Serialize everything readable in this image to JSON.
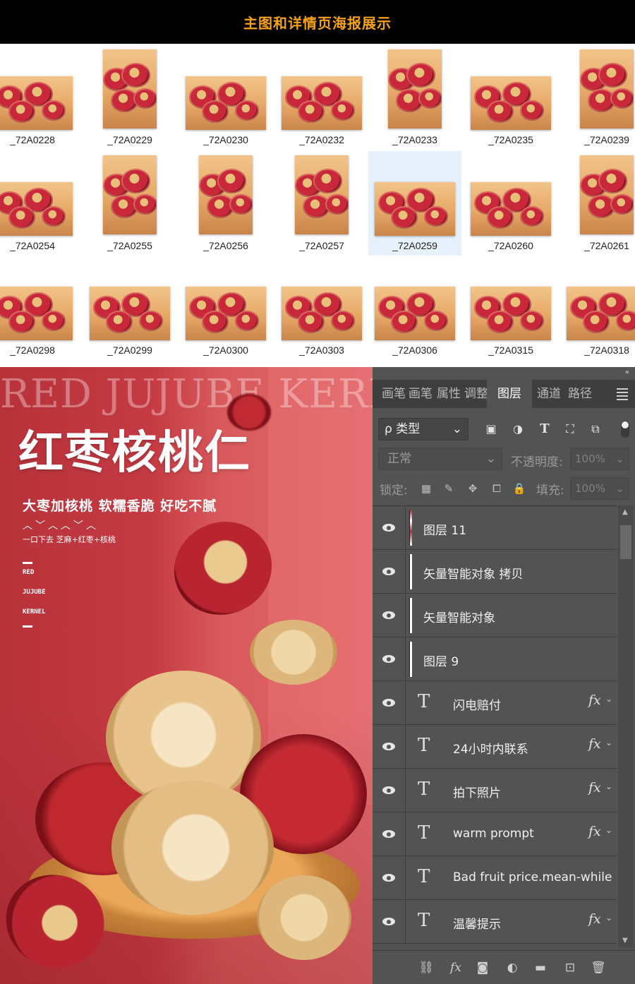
{
  "header": {
    "title": "主图和详情页海报展示"
  },
  "thumbnails": [
    {
      "label": "_72A0228",
      "orientation": "landscape",
      "selected": false
    },
    {
      "label": "_72A0229",
      "orientation": "portrait",
      "selected": false
    },
    {
      "label": "_72A0230",
      "orientation": "landscape",
      "selected": false
    },
    {
      "label": "_72A0232",
      "orientation": "landscape",
      "selected": false
    },
    {
      "label": "_72A0233",
      "orientation": "portrait",
      "selected": false
    },
    {
      "label": "_72A0235",
      "orientation": "landscape",
      "selected": false
    },
    {
      "label": "_72A0239",
      "orientation": "portrait",
      "selected": false
    },
    {
      "label": "_72A0254",
      "orientation": "landscape",
      "selected": false
    },
    {
      "label": "_72A0255",
      "orientation": "portrait",
      "selected": false
    },
    {
      "label": "_72A0256",
      "orientation": "portrait",
      "selected": false
    },
    {
      "label": "_72A0257",
      "orientation": "portrait",
      "selected": false
    },
    {
      "label": "_72A0259",
      "orientation": "landscape",
      "selected": true
    },
    {
      "label": "_72A0260",
      "orientation": "landscape",
      "selected": false
    },
    {
      "label": "_72A0261",
      "orientation": "portrait",
      "selected": false
    },
    {
      "label": "_72A0298",
      "orientation": "landscape",
      "selected": false
    },
    {
      "label": "_72A0299",
      "orientation": "landscape",
      "selected": false
    },
    {
      "label": "_72A0300",
      "orientation": "landscape",
      "selected": false
    },
    {
      "label": "_72A0303",
      "orientation": "landscape",
      "selected": false
    },
    {
      "label": "_72A0306",
      "orientation": "landscape",
      "selected": false
    },
    {
      "label": "_72A0315",
      "orientation": "landscape",
      "selected": false
    },
    {
      "label": "_72A0318",
      "orientation": "landscape",
      "selected": false
    }
  ],
  "poster": {
    "english_title": "RED JUJUBE KERNEL",
    "title": "红枣核桃仁",
    "subtitle": "大枣加核桃 软糯香脆 好吃不腻",
    "wave": "︿﹀︿︿﹀︿",
    "tagline": "一口下去 芝麻+红枣+核桃",
    "small_lines": [
      "RED",
      "JUJUBE",
      "KERNEL"
    ]
  },
  "layers_panel": {
    "collapse_glyph": "«",
    "tabs": [
      {
        "label": "画笔",
        "active": false
      },
      {
        "label": "画笔",
        "active": false
      },
      {
        "label": "属性",
        "active": false
      },
      {
        "label": "调整",
        "active": false
      },
      {
        "label": "图层",
        "active": true
      },
      {
        "label": "通道",
        "active": false
      },
      {
        "label": "路径",
        "active": false
      }
    ],
    "filter": {
      "label": "ρ 类型",
      "chevron": "⌄"
    },
    "filter_icons": [
      "image-filter-icon",
      "adjustment-filter-icon",
      "type-filter-icon",
      "shape-filter-icon",
      "smart-object-filter-icon"
    ],
    "filter_glyphs": [
      "▣",
      "◑",
      "T",
      "⛶",
      "⧉"
    ],
    "blend_mode": "正常",
    "opacity_label": "不透明度:",
    "opacity_value": "100%",
    "lock_label": "锁定:",
    "lock_glyphs": [
      "▦",
      "✎",
      "✥",
      "⧠",
      "🔒"
    ],
    "fill_label": "填充:",
    "fill_value": "100%",
    "layers": [
      {
        "type": "image",
        "name": "图层 11",
        "fx": false,
        "thumb": "colored"
      },
      {
        "type": "image",
        "name": "矢量智能对象 拷贝",
        "fx": false,
        "thumb": "plain"
      },
      {
        "type": "image",
        "name": "矢量智能对象",
        "fx": false,
        "thumb": "plain"
      },
      {
        "type": "image",
        "name": "图层 9",
        "fx": false,
        "thumb": "plain"
      },
      {
        "type": "text",
        "name": "闪电赔付",
        "fx": true
      },
      {
        "type": "text",
        "name": "24小时内联系",
        "fx": true
      },
      {
        "type": "text",
        "name": "拍下照片",
        "fx": true
      },
      {
        "type": "text",
        "name": "warm prompt",
        "fx": true
      },
      {
        "type": "text",
        "name": "Bad fruit price.mean-while",
        "fx": false
      },
      {
        "type": "text",
        "name": "温馨提示",
        "fx": true
      }
    ],
    "text_layer_glyph": "T",
    "fx_glyph": "fx",
    "chevron_glyph": "⌄",
    "footer_icons": [
      {
        "name": "link-layers-icon",
        "glyph": "⛓"
      },
      {
        "name": "layer-style-fx-icon",
        "glyph": "fx"
      },
      {
        "name": "add-mask-icon",
        "glyph": "◙"
      },
      {
        "name": "adjustment-layer-icon",
        "glyph": "◐"
      },
      {
        "name": "new-group-folder-icon",
        "glyph": "▬"
      },
      {
        "name": "new-layer-icon",
        "glyph": "⊡"
      },
      {
        "name": "delete-layer-icon",
        "glyph": "🗑"
      }
    ],
    "colors": {
      "panel_bg": "#535353",
      "tab_bar": "#3e3e3e",
      "accent_title": "#f5a21a"
    }
  }
}
